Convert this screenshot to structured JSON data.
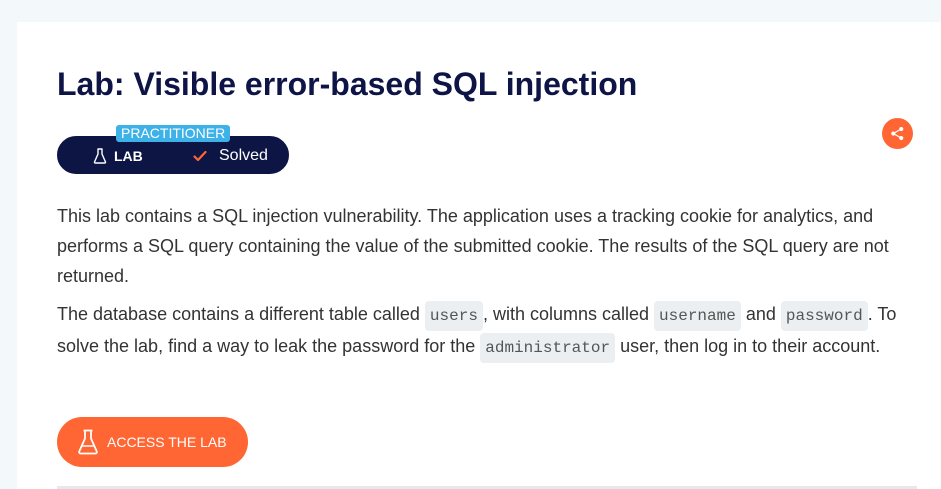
{
  "page": {
    "title": "Lab: Visible error-based SQL injection"
  },
  "status": {
    "level": "PRACTITIONER",
    "lab_label": "LAB",
    "solved_label": "Solved"
  },
  "share": {
    "icon": "share-icon",
    "color": "#ff6633"
  },
  "description": {
    "p1": "This lab contains a SQL injection vulnerability. The application uses a tracking cookie for analytics, and performs a SQL query containing the value of the submitted cookie. The results of the SQL query are not returned.",
    "p2": {
      "t1": "The database contains a different table called ",
      "c1": "users",
      "t2": ", with columns called ",
      "c2": "username",
      "t3": " and ",
      "c3": "password",
      "t4": ". To solve the lab, find a way to leak the password for the ",
      "c4": "administrator",
      "t5": " user, then log in to their account."
    }
  },
  "cta": {
    "label": "ACCESS THE LAB",
    "icon": "flask-icon"
  },
  "colors": {
    "accent": "#ff6633",
    "navy": "#0d1544",
    "badge": "#3cb2e9"
  }
}
